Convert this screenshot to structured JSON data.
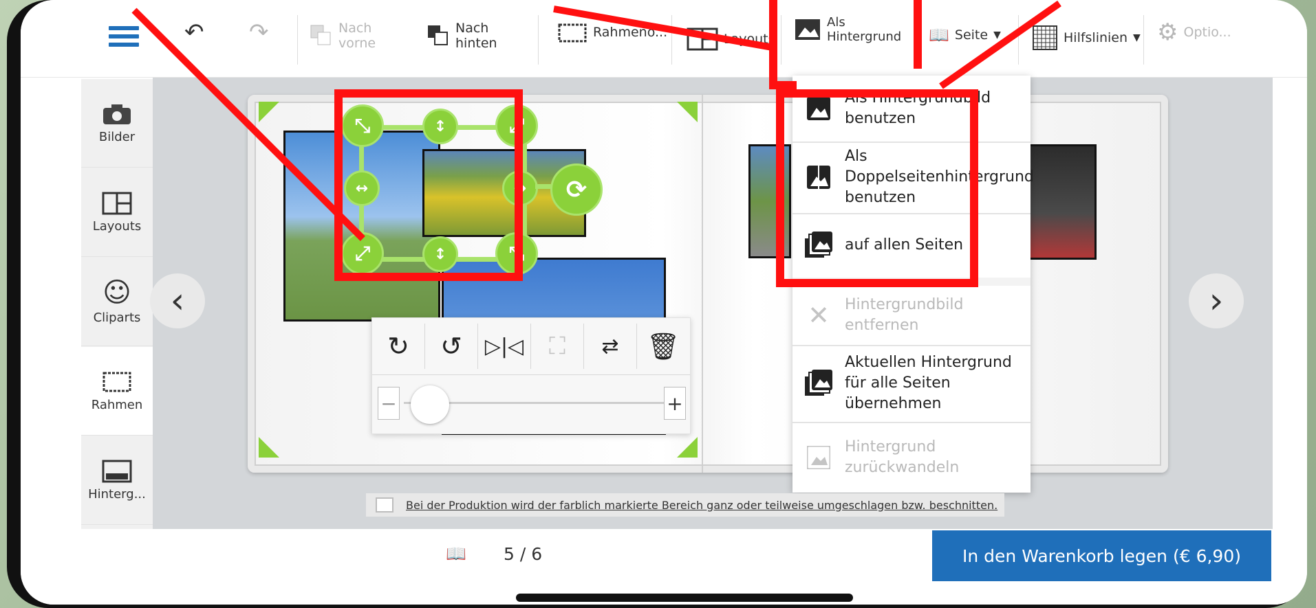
{
  "toolbar": {
    "vorne_l1": "Nach",
    "vorne_l2": "vorne",
    "hinten_l1": "Nach",
    "hinten_l2": "hinten",
    "rahmen": "Rahmeno...",
    "layouts": "Layouts",
    "als1": "Als",
    "als2": "Hintergrund",
    "seite": "Seite",
    "hilfslinien": "Hilfslinien",
    "optionen": "Optio..."
  },
  "sidebar": {
    "items": [
      {
        "label": "Bilder"
      },
      {
        "label": "Layouts"
      },
      {
        "label": "Cliparts"
      },
      {
        "label": "Rahmen"
      },
      {
        "label": "Hinterg..."
      }
    ]
  },
  "menu": {
    "items": [
      {
        "l1": "Als Hintergrundbild",
        "l2": "benutzen",
        "l3": ""
      },
      {
        "l1": "Als",
        "l2": "Doppelseitenhintergrund",
        "l3": "benutzen"
      },
      {
        "l1": "auf allen Seiten",
        "l2": "",
        "l3": ""
      },
      {
        "l1": "Hintergrundbild",
        "l2": "entfernen",
        "l3": ""
      },
      {
        "l1": "Aktuellen Hintergrund",
        "l2": "für alle Seiten",
        "l3": "übernehmen"
      },
      {
        "l1": "Hintergrund",
        "l2": "zurückwandeln",
        "l3": ""
      }
    ]
  },
  "notice": "Bei der Produktion wird der farblich markierte Bereich ganz oder teilweise umgeschlagen bzw. beschnitten.",
  "pager": {
    "current": "5 / 6"
  },
  "cart": {
    "label": "In den Warenkorb legen (€ 6,90)"
  },
  "colors": {
    "accent": "#1f6fba",
    "highlight": "#ff1010",
    "selection": "#8bd13a"
  },
  "icons": [
    "hamburger-icon",
    "undo-icon",
    "redo-icon",
    "bring-forward-icon",
    "send-backward-icon",
    "frame-icon",
    "layout-icon",
    "background-icon",
    "book-icon",
    "grid-icon",
    "gear-icon",
    "camera-icon",
    "smiley-icon",
    "rotate-right-icon",
    "rotate-left-icon",
    "flip-icon",
    "crop-icon",
    "swap-icon",
    "trash-icon"
  ]
}
